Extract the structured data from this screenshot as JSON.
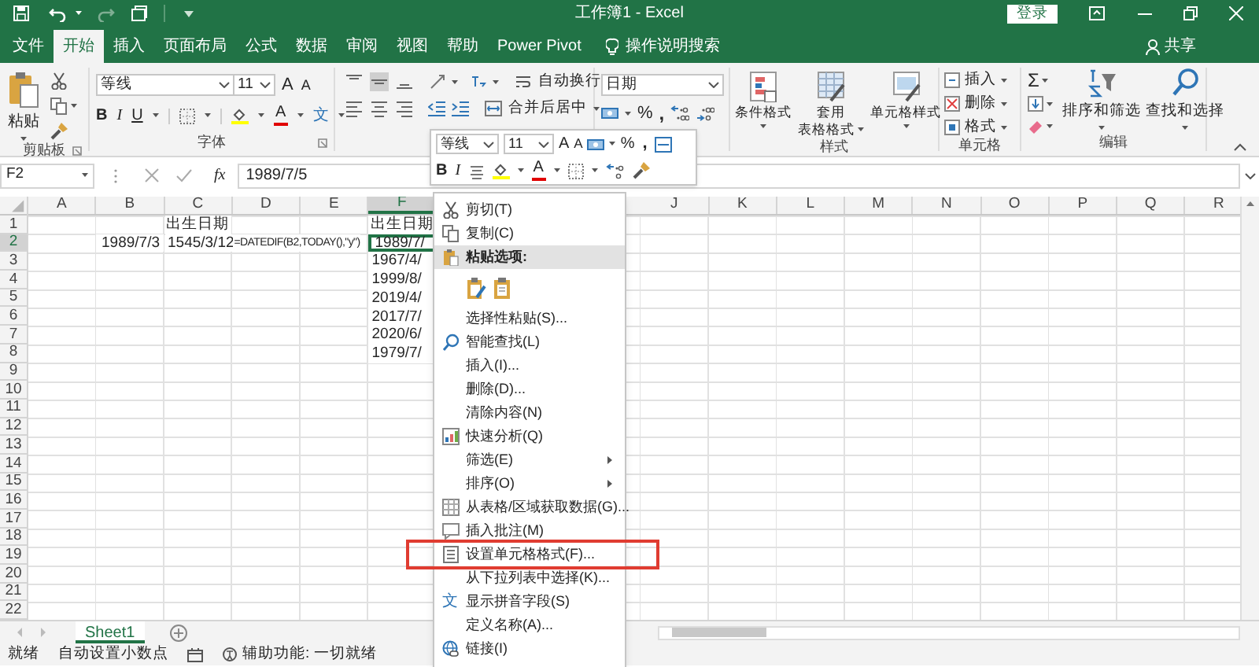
{
  "title_bar": {
    "title": "工作簿1 - Excel",
    "login_button": "登录"
  },
  "tabs": [
    {
      "label": "文件",
      "selected": false
    },
    {
      "label": "开始",
      "selected": true
    },
    {
      "label": "插入",
      "selected": false
    },
    {
      "label": "页面布局",
      "selected": false
    },
    {
      "label": "公式",
      "selected": false
    },
    {
      "label": "数据",
      "selected": false
    },
    {
      "label": "审阅",
      "selected": false
    },
    {
      "label": "视图",
      "selected": false
    },
    {
      "label": "帮助",
      "selected": false
    },
    {
      "label": "Power Pivot",
      "selected": false
    }
  ],
  "tell_me": "操作说明搜索",
  "share": "共享",
  "ribbon": {
    "clipboard": {
      "paste": "粘贴",
      "label": "剪贴板"
    },
    "font": {
      "name": "等线",
      "size": "11",
      "grow": "A",
      "shrink": "A",
      "bold": "B",
      "italic": "I",
      "underline": "U",
      "font_color": "A",
      "phonetic": "文",
      "label": "字体"
    },
    "alignment": {
      "wrap": "自动换行",
      "merge": "合并后居中"
    },
    "number": {
      "format": "日期",
      "percent": "%",
      "comma": ","
    },
    "styles": {
      "buttons": [
        {
          "lines": [
            "条件格式"
          ]
        },
        {
          "lines": [
            "套用",
            "表格格式"
          ]
        },
        {
          "lines": [
            "单元格样式"
          ]
        }
      ],
      "label": "样式"
    },
    "cells": {
      "buttons": [
        "插入",
        "删除",
        "格式"
      ],
      "label": "单元格"
    },
    "editing": {
      "autosum": "Σ",
      "sort": "排序和筛选",
      "find": "查找和选择",
      "label": "编辑"
    }
  },
  "formula_bar": {
    "name_box": "F2",
    "fx": "fx",
    "value": "1989/7/5"
  },
  "sheet": {
    "columns": [
      "A",
      "B",
      "C",
      "D",
      "E",
      "F",
      "J",
      "K",
      "L",
      "M",
      "N",
      "O",
      "P",
      "Q",
      "R"
    ],
    "rows": [
      {
        "number": "1",
        "cells": {
          "C": {
            "text": "出生日期",
            "kind": "heading",
            "selected": false
          },
          "F": {
            "text": "出生日期",
            "kind": "heading",
            "selected": false
          }
        }
      },
      {
        "number": "2",
        "cells": {
          "B": {
            "text": "1989/7/3",
            "kind": "date",
            "selected": false
          },
          "C": {
            "text": "1545/3/12",
            "kind": "text",
            "selected": false
          },
          "D": {
            "text": "=DATEDIF(B2,TODAY(),\"y\")",
            "kind": "formula",
            "selected": false
          },
          "F": {
            "text": "1989/7/",
            "kind": "text",
            "selected": true
          }
        }
      },
      {
        "number": "3",
        "cells": {
          "F": {
            "text": "1967/4/",
            "kind": "text",
            "selected": false
          }
        }
      },
      {
        "number": "4",
        "cells": {
          "F": {
            "text": "1999/8/",
            "kind": "text",
            "selected": false
          }
        }
      },
      {
        "number": "5",
        "cells": {
          "F": {
            "text": "2019/4/",
            "kind": "text",
            "selected": false
          }
        }
      },
      {
        "number": "6",
        "cells": {
          "F": {
            "text": "2017/7/",
            "kind": "text",
            "selected": false
          }
        }
      },
      {
        "number": "7",
        "cells": {
          "F": {
            "text": "2020/6/",
            "kind": "text",
            "selected": false
          }
        }
      },
      {
        "number": "8",
        "cells": {
          "F": {
            "text": "1979/7/",
            "kind": "text",
            "selected": false
          }
        }
      },
      {
        "number": "9"
      },
      {
        "number": "10"
      },
      {
        "number": "11"
      },
      {
        "number": "12"
      },
      {
        "number": "13"
      },
      {
        "number": "14"
      },
      {
        "number": "15"
      },
      {
        "number": "16"
      },
      {
        "number": "17"
      },
      {
        "number": "18"
      },
      {
        "number": "19"
      },
      {
        "number": "20"
      },
      {
        "number": "21"
      },
      {
        "number": "22"
      }
    ]
  },
  "sheet_tabs": [
    {
      "label": "Sheet1",
      "selected": true
    }
  ],
  "status_bar": {
    "ready": "就绪",
    "auto_decimal": "自动设置小数点",
    "accessibility": "辅助功能: 一切就绪"
  },
  "mini_toolbar": {
    "font": "等线",
    "size": "11",
    "grow": "A",
    "shrink": "A",
    "percent": "%",
    "comma": ",",
    "bold": "B",
    "italic": "I",
    "font_color": "A"
  },
  "context_menu": [
    {
      "kind": "item",
      "label": "剪切(T)",
      "highlighted": false
    },
    {
      "kind": "item",
      "label": "复制(C)",
      "highlighted": false
    },
    {
      "kind": "header",
      "label": "粘贴选项:",
      "highlighted": true
    },
    {
      "kind": "paste-options",
      "highlighted": false
    },
    {
      "kind": "item",
      "label": "选择性粘贴(S)...",
      "highlighted": false
    },
    {
      "kind": "item",
      "label": "智能查找(L)",
      "highlighted": false
    },
    {
      "kind": "item",
      "label": "插入(I)...",
      "highlighted": false
    },
    {
      "kind": "item",
      "label": "删除(D)...",
      "highlighted": false
    },
    {
      "kind": "item",
      "label": "清除内容(N)",
      "highlighted": false
    },
    {
      "kind": "item",
      "label": "快速分析(Q)",
      "highlighted": false
    },
    {
      "kind": "submenu",
      "label": "筛选(E)",
      "highlighted": false
    },
    {
      "kind": "submenu",
      "label": "排序(O)",
      "highlighted": false
    },
    {
      "kind": "item",
      "label": "从表格/区域获取数据(G)...",
      "highlighted": false
    },
    {
      "kind": "item",
      "label": "插入批注(M)",
      "highlighted": false
    },
    {
      "kind": "item",
      "label": "设置单元格格式(F)...",
      "highlighted": false
    },
    {
      "kind": "item",
      "label": "从下拉列表中选择(K)...",
      "highlighted": false
    },
    {
      "kind": "item",
      "label": "显示拼音字段(S)",
      "glyph": "文",
      "highlighted": false
    },
    {
      "kind": "item",
      "label": "定义名称(A)...",
      "highlighted": false
    },
    {
      "kind": "item",
      "label": "链接(I)",
      "highlighted": false
    }
  ]
}
